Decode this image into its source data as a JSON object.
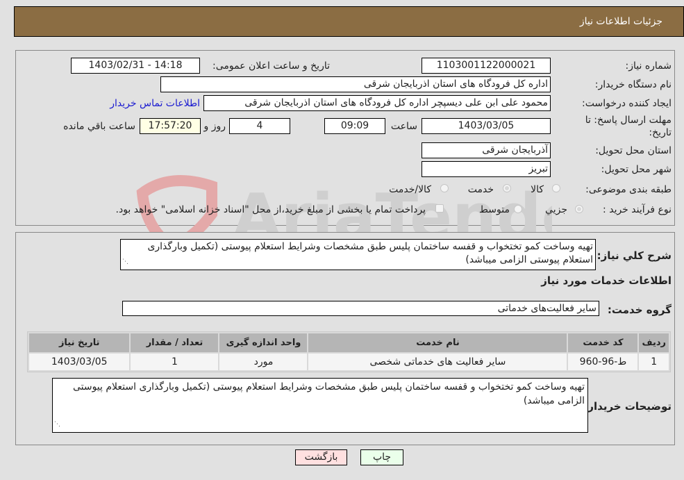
{
  "header": {
    "title": "جزئیات اطلاعات نیاز"
  },
  "fields": {
    "need_number_label": "شماره نیاز:",
    "need_number": "1103001122000021",
    "announce_label": "تاریخ و ساعت اعلان عمومی:",
    "announce_value": "1403/02/31 - 14:18",
    "buyer_org_label": "نام دستگاه خریدار:",
    "buyer_org": "اداره کل فرودگاه های استان اذربایجان شرقی",
    "creator_label": "ایجاد کننده درخواست:",
    "creator": "محمود علی ابن علی دیسپچر اداره کل فرودگاه های استان اذربایجان شرقی",
    "contact_link": "اطلاعات تماس خریدار",
    "deadline_label_line1": "مهلت ارسال پاسخ: تا",
    "deadline_label_line2": "تاریخ:",
    "deadline_date": "1403/03/05",
    "time_label": "ساعت",
    "deadline_time": "09:09",
    "days_value": "4",
    "days_label": "روز و",
    "remaining_time": "17:57:20",
    "remaining_label": "ساعت باقي مانده",
    "province_label": "استان محل تحویل:",
    "province": "آذربایجان شرقی",
    "city_label": "شهر محل تحویل:",
    "city": "تبریز",
    "category_label": "طبقه بندی موضوعی:",
    "category_options": [
      "کالا",
      "خدمت",
      "کالا/خدمت"
    ],
    "category_selected": "خدمت",
    "purchase_type_label": "نوع فرآیند خرید :",
    "purchase_type_options": [
      "جزیي",
      "متوسط"
    ],
    "purchase_type_selected": "جزیي",
    "treasury_note": "پرداخت تمام یا بخشی از مبلغ خرید،از محل \"اسناد خزانه اسلامی\" خواهد بود."
  },
  "description": {
    "label": "شرح کلي نیاز:",
    "text": "تهیه وساخت کمو تختخواب و قفسه ساختمان پلیس طبق مشخصات وشرایط استعلام پیوستی (تکمیل وبارگذاری استعلام پیوستی الزامی میباشد)"
  },
  "services": {
    "section_title": "اطلاعات خدمات مورد نیاز",
    "group_label": "گروه خدمت:",
    "group_value": "سایر فعالیت‌های خدماتی",
    "table": {
      "headers": [
        "ردیف",
        "کد خدمت",
        "نام خدمت",
        "واحد اندازه گیری",
        "تعداد / مقدار",
        "تاریخ نیاز"
      ],
      "rows": [
        [
          "1",
          "ط-96-960",
          "سایر فعالیت های خدماتی شخصی",
          "مورد",
          "1",
          "1403/03/05"
        ]
      ]
    }
  },
  "buyer_notes": {
    "label": "توضیحات خریدار:",
    "text": "تهیه وساخت کمو تختخواب و قفسه ساختمان پلیس طبق مشخصات وشرایط استعلام پیوستی (تکمیل وبارگذاری استعلام پیوستی الزامی میباشد)"
  },
  "buttons": {
    "print": "چاپ",
    "back": "بازگشت"
  },
  "watermark": {
    "text": "AriaTender.net"
  },
  "colors": {
    "header_bg": "#8b6d43",
    "link": "#1a1ad0",
    "print_bg": "#eaffea",
    "back_bg": "#ffe0e0",
    "remaining_bg": "#ffffe5"
  }
}
